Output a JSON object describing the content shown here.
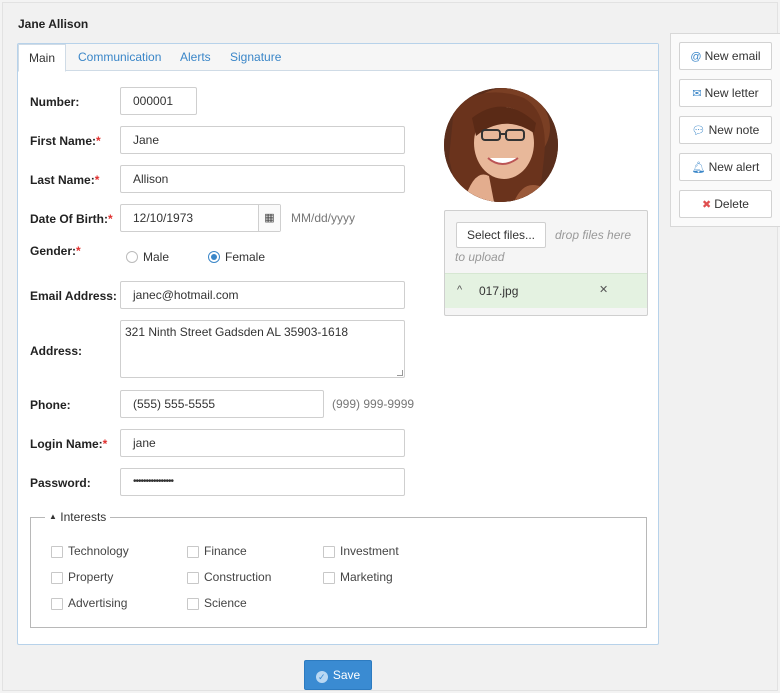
{
  "header": {
    "title": "Jane Allison"
  },
  "tabs": [
    {
      "label": "Main"
    },
    {
      "label": "Communication"
    },
    {
      "label": "Alerts"
    },
    {
      "label": "Signature"
    }
  ],
  "form": {
    "number": {
      "label": "Number:",
      "value": "000001"
    },
    "first_name": {
      "label": "First Name:",
      "required": "*",
      "value": "Jane"
    },
    "last_name": {
      "label": "Last Name:",
      "required": "*",
      "value": "Allison"
    },
    "dob": {
      "label": "Date Of Birth:",
      "required": "*",
      "value": "12/10/1973",
      "hint": "MM/dd/yyyy"
    },
    "gender": {
      "label": "Gender:",
      "required": "*",
      "options": [
        "Male",
        "Female"
      ],
      "selected": "Female"
    },
    "email": {
      "label": "Email Address:",
      "value": "janec@hotmail.com"
    },
    "address": {
      "label": "Address:",
      "value": "321 Ninth Street Gadsden AL 35903-1618"
    },
    "phone": {
      "label": "Phone:",
      "value": "(555) 555-5555",
      "hint": "(999) 999-9999"
    },
    "login": {
      "label": "Login Name:",
      "required": "*",
      "value": "jane"
    },
    "password": {
      "label": "Password:",
      "value": "••••••••••••••••"
    }
  },
  "interests": {
    "legend": "Interests",
    "items": [
      "Technology",
      "Finance",
      "Investment",
      "Property",
      "Construction",
      "Marketing",
      "Advertising",
      "Science"
    ]
  },
  "upload": {
    "select_label": "Select files...",
    "drop_text_1": "drop files here",
    "drop_text_2": "to upload",
    "file_name": "017.jpg",
    "remove_glyph": "✕"
  },
  "actions": {
    "new_email": "New email",
    "new_letter": "New letter",
    "new_note": "New note",
    "new_alert": "New alert",
    "delete": "Delete"
  },
  "footer": {
    "save_label": "Save"
  },
  "colors": {
    "accent": "#3a86c8",
    "required": "#e0302f",
    "save": "#3a8bd2"
  }
}
